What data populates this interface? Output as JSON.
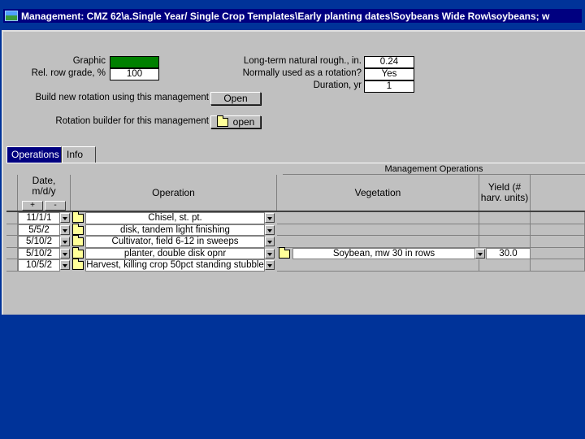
{
  "window": {
    "title": "Management:  CMZ 62\\a.Single Year/ Single Crop Templates\\Early planting dates\\Soybeans Wide Row\\soybeans; w"
  },
  "props": {
    "graphic_label": "Graphic",
    "graphic_color": "#008000",
    "row_grade_label": "Rel. row grade, %",
    "row_grade_value": "100",
    "rough_label": "Long-term natural rough., in.",
    "rough_value": "0.24",
    "rotation_label": "Normally used as a rotation?",
    "rotation_value": "Yes",
    "duration_label": "Duration, yr",
    "duration_value": "1",
    "build_label": "Build new rotation using this management",
    "build_button": "Open",
    "builder_label": "Rotation builder for this management",
    "builder_button": "open"
  },
  "tabs": [
    {
      "label": "Operations",
      "active": true
    },
    {
      "label": "Info",
      "active": false
    }
  ],
  "table": {
    "group_header": "Management Operations",
    "col_date_l1": "Date,",
    "col_date_l2": "m/d/y",
    "sort_plus": "+",
    "sort_minus": "-",
    "col_operation": "Operation",
    "col_vegetation": "Vegetation",
    "col_yield_l1": "Yield (#",
    "col_yield_l2": "harv. units)",
    "rows": [
      {
        "date": "11/1/1",
        "operation": "Chisel, st. pt.",
        "vegetation": "",
        "yield": ""
      },
      {
        "date": "5/5/2",
        "operation": "disk, tandem light finishing",
        "vegetation": "",
        "yield": ""
      },
      {
        "date": "5/10/2",
        "operation": "Cultivator, field 6-12 in sweeps",
        "vegetation": "",
        "yield": ""
      },
      {
        "date": "5/10/2",
        "operation": "planter, double disk opnr",
        "vegetation": "Soybean, mw 30 in rows",
        "yield": "30.0"
      },
      {
        "date": "10/5/2",
        "operation": "Harvest, killing crop 50pct standing stubble",
        "vegetation": "",
        "yield": ""
      }
    ]
  }
}
